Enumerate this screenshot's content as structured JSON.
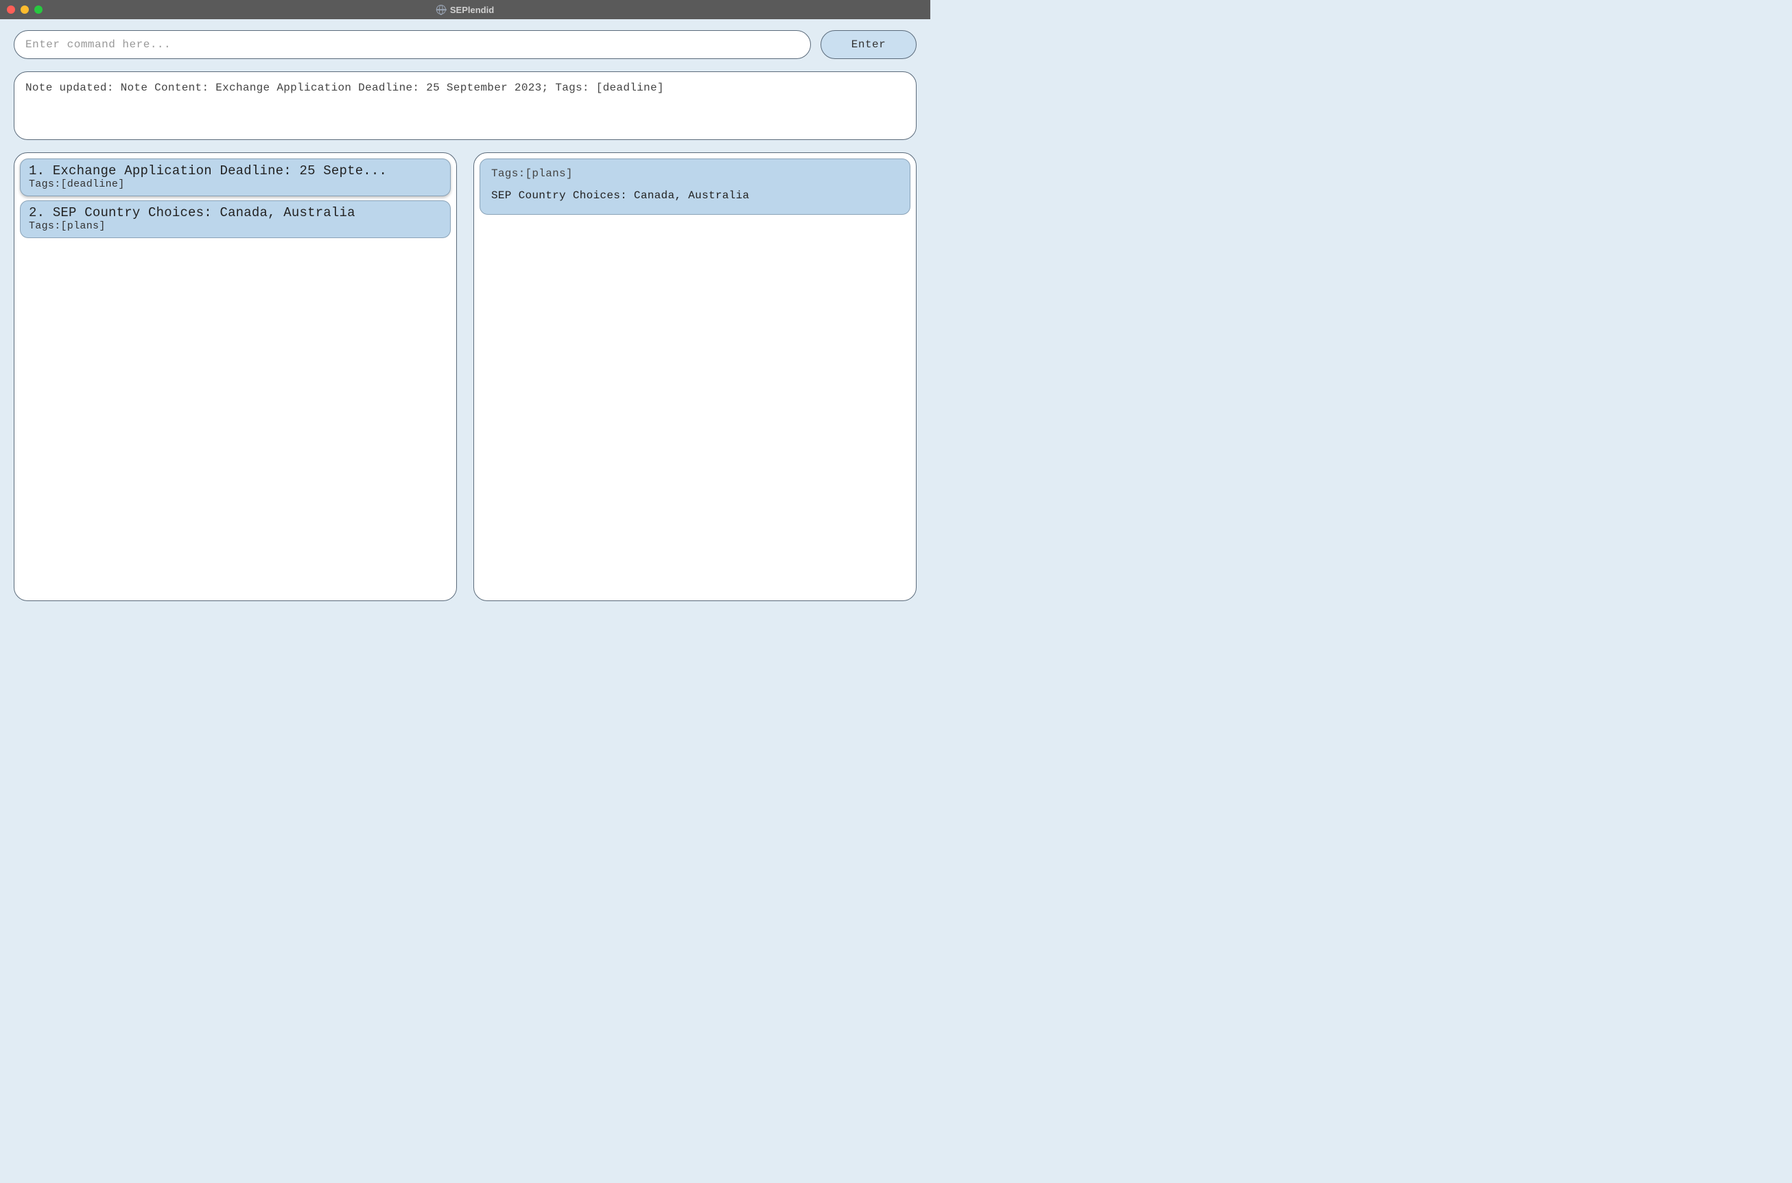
{
  "window": {
    "title": "SEPlendid"
  },
  "commandBar": {
    "placeholder": "Enter command here...",
    "value": "",
    "buttonLabel": "Enter"
  },
  "feedback": {
    "message": "Note updated: Note Content: Exchange Application Deadline: 25 September 2023; Tags: [deadline]"
  },
  "notesList": [
    {
      "index": "1.",
      "title": "Exchange Application Deadline: 25 Septe...",
      "tagsLine": "Tags:[deadline]"
    },
    {
      "index": "2.",
      "title": "SEP Country Choices: Canada, Australia",
      "tagsLine": "Tags:[plans]"
    }
  ],
  "detail": {
    "tagsLine": "Tags:[plans]",
    "content": "SEP Country Choices: Canada, Australia"
  }
}
